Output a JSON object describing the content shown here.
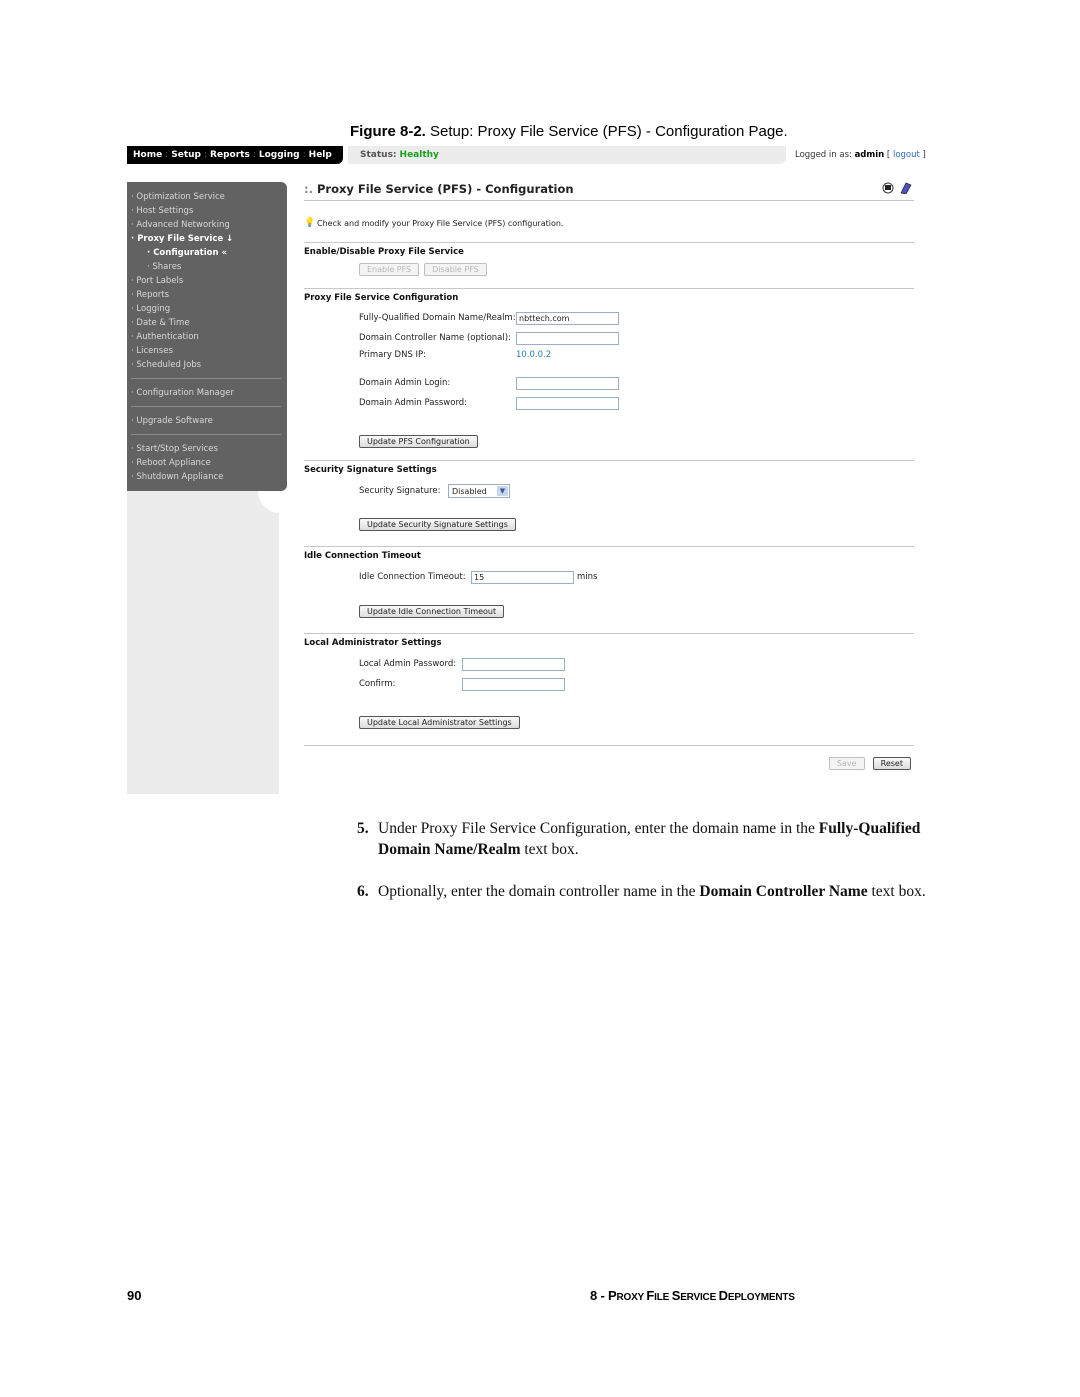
{
  "caption": {
    "label": "Figure 8-2.",
    "text": " Setup: Proxy File Service (PFS) - Configuration Page."
  },
  "nav": {
    "items": [
      "Home",
      "Setup",
      "Reports",
      "Logging",
      "Help"
    ],
    "separator": ":",
    "status_label": "Status:",
    "status_value": "Healthy",
    "logged_in_label": "Logged in as:",
    "user": "admin",
    "logout": "logout"
  },
  "sidebar": {
    "groups": [
      [
        {
          "label": "Optimization Service",
          "bullet": "·"
        },
        {
          "label": "Host Settings",
          "bullet": "·"
        },
        {
          "label": "Advanced Networking",
          "bullet": "·"
        },
        {
          "label": "Proxy File Service ↓",
          "bullet": "·",
          "active": true
        },
        {
          "label": "Configuration «",
          "bullet": "·",
          "active": true,
          "sub": true
        },
        {
          "label": "Shares",
          "bullet": "·",
          "sub": true
        },
        {
          "label": "Port Labels",
          "bullet": "·"
        },
        {
          "label": "Reports",
          "bullet": "·"
        },
        {
          "label": "Logging",
          "bullet": "·"
        },
        {
          "label": "Date & Time",
          "bullet": "·"
        },
        {
          "label": "Authentication",
          "bullet": "·"
        },
        {
          "label": "Licenses",
          "bullet": "·"
        },
        {
          "label": "Scheduled Jobs",
          "bullet": "·"
        }
      ],
      [
        {
          "label": "Configuration Manager",
          "bullet": "·"
        }
      ],
      [
        {
          "label": "Upgrade Software",
          "bullet": "·"
        }
      ],
      [
        {
          "label": "Start/Stop Services",
          "bullet": "·"
        },
        {
          "label": "Reboot Appliance",
          "bullet": "·"
        },
        {
          "label": "Shutdown Appliance",
          "bullet": "·"
        }
      ]
    ]
  },
  "main": {
    "title_prefix": ":.",
    "title": "Proxy File Service (PFS) - Configuration",
    "hint": "Check and modify your Proxy File Service (PFS) configuration.",
    "enable_section": {
      "title": "Enable/Disable Proxy File Service",
      "enable_btn": "Enable PFS",
      "disable_btn": "Disable PFS"
    },
    "pfs_section": {
      "title": "Proxy File Service Configuration",
      "fqdn_label": "Fully-Qualified Domain Name/Realm:",
      "fqdn_value": "nbttech.com",
      "dc_label": "Domain Controller Name (optional):",
      "dc_value": "",
      "dns_label": "Primary DNS IP:",
      "dns_value": "10.0.0.2",
      "login_label": "Domain Admin Login:",
      "login_value": "",
      "password_label": "Domain Admin Password:",
      "password_value": "",
      "update_btn": "Update PFS Configuration"
    },
    "security_section": {
      "title": "Security Signature Settings",
      "label": "Security Signature:",
      "value": "Disabled",
      "update_btn": "Update Security Signature Settings"
    },
    "idle_section": {
      "title": "Idle Connection Timeout",
      "label": "Idle Connection Timeout:",
      "value": "15",
      "unit": "mins",
      "update_btn": "Update Idle Connection Timeout"
    },
    "local_admin_section": {
      "title": "Local Administrator Settings",
      "password_label": "Local Admin Password:",
      "confirm_label": "Confirm:",
      "update_btn": "Update Local Administrator Settings"
    },
    "save_btn": "Save",
    "reset_btn": "Reset"
  },
  "steps": [
    {
      "num": "5.",
      "pre": "Under Proxy File Service Configuration, enter the domain name in the ",
      "bold": "Fully-Qualified Domain Name/Realm",
      "post": " text box."
    },
    {
      "num": "6.",
      "pre": "Optionally, enter the domain controller name in the ",
      "bold": "Domain Controller Name",
      "post": " text box."
    }
  ],
  "footer": {
    "page": "90",
    "chapter_num": "8 - ",
    "chapter": [
      [
        "P",
        "ROXY "
      ],
      [
        "F",
        "ILE "
      ],
      [
        "S",
        "ERVICE "
      ],
      [
        "D",
        "EPLOYMENTS"
      ]
    ]
  }
}
